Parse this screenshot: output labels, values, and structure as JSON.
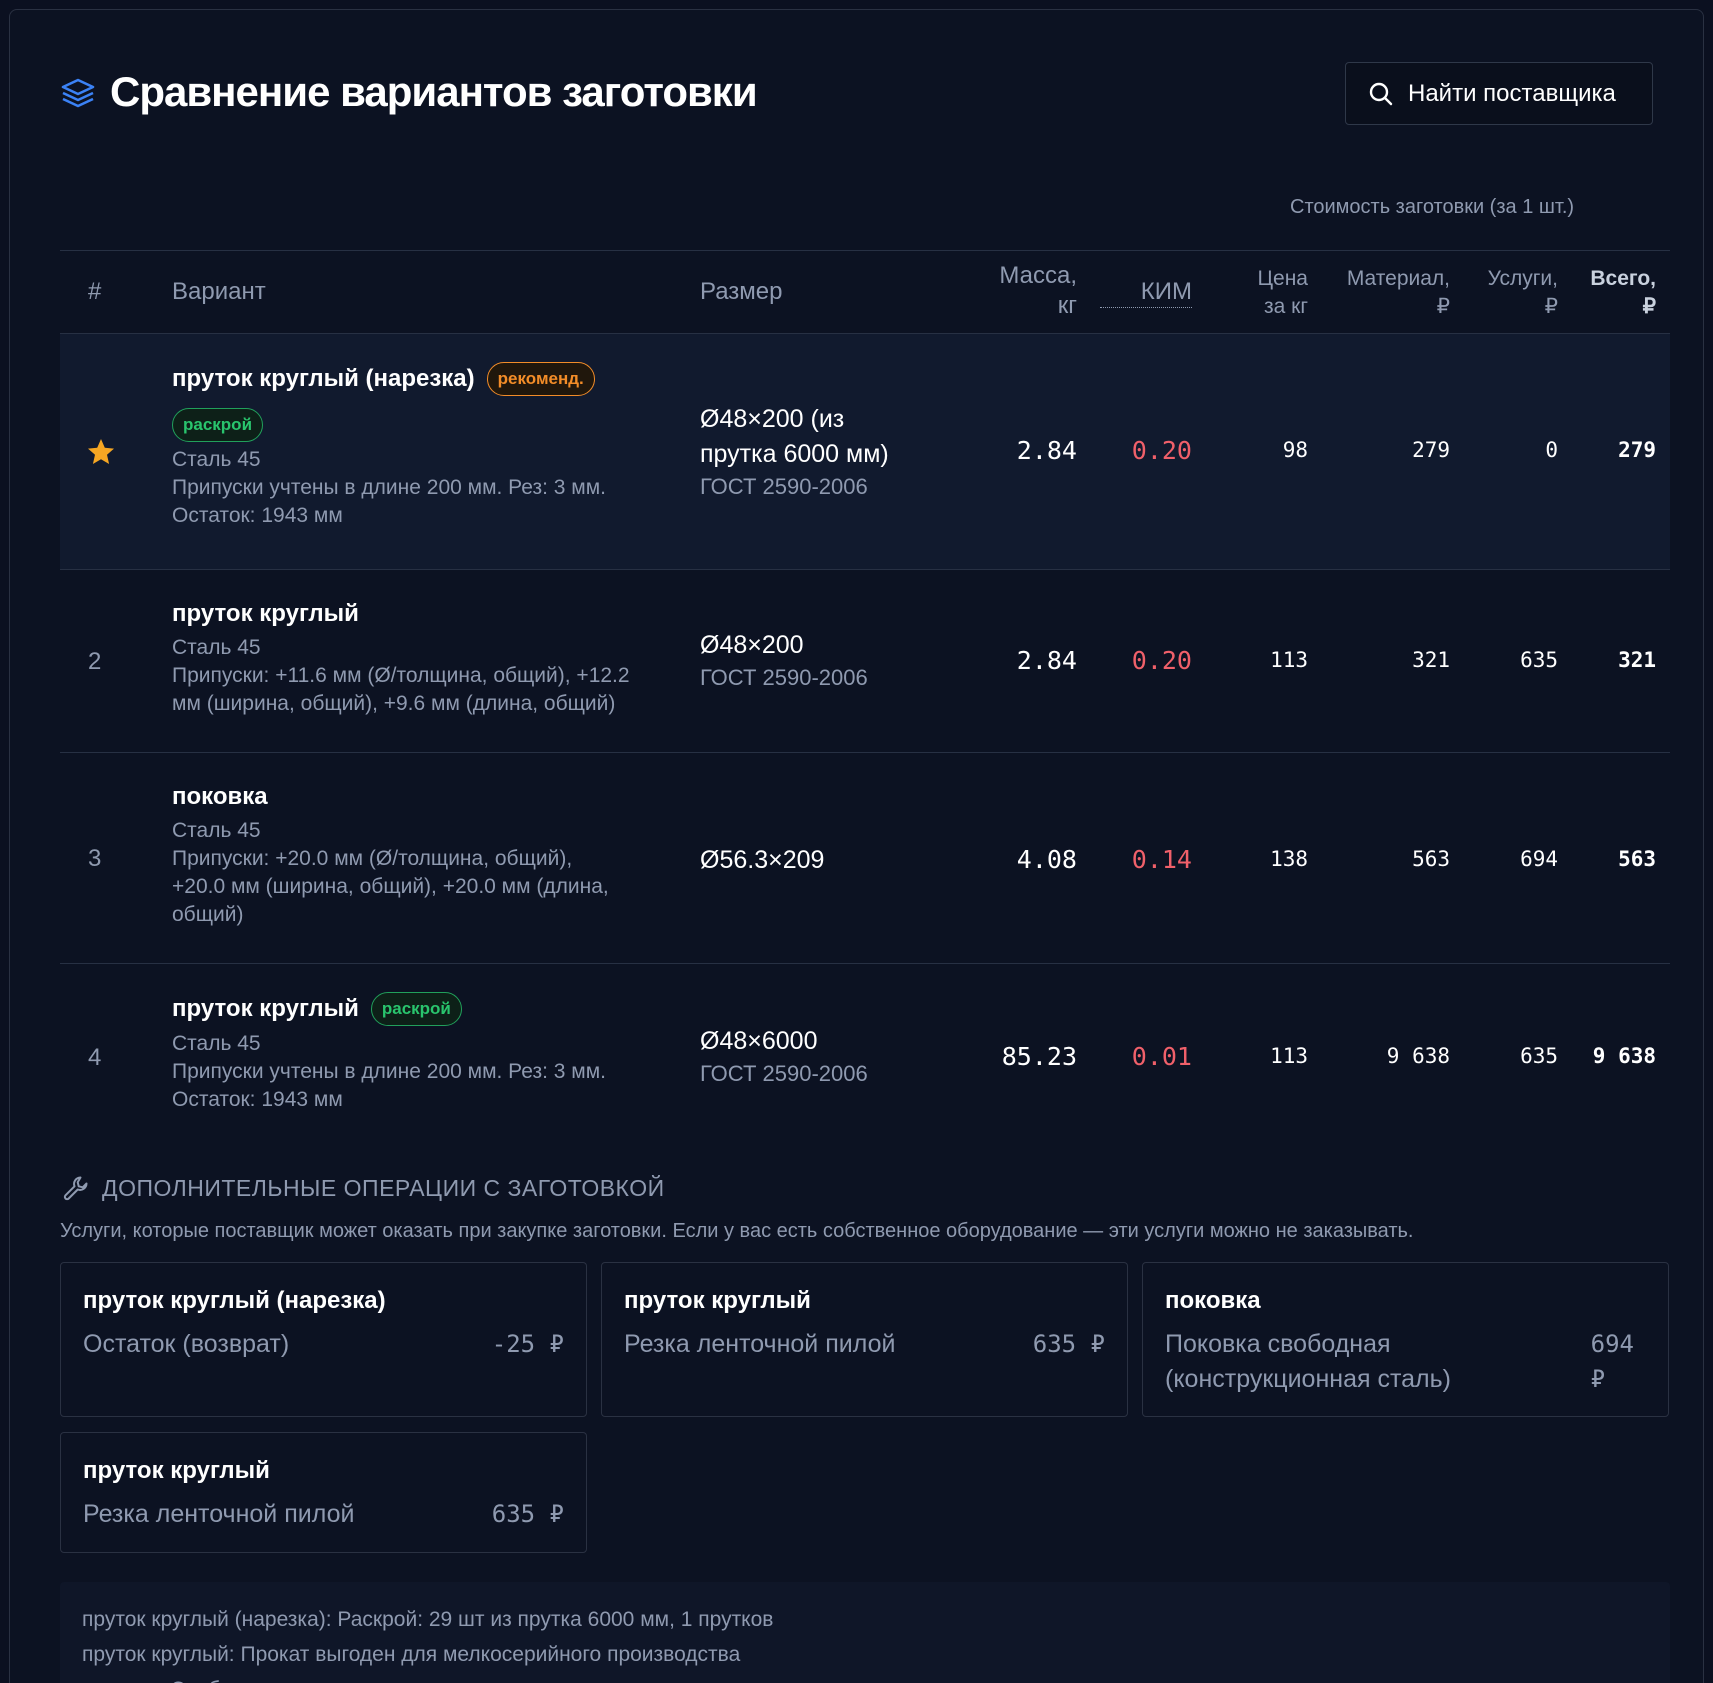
{
  "header": {
    "title": "Сравнение вариантов заготовки",
    "find_button": "Найти поставщика",
    "title_icon": "layers-icon",
    "find_icon": "search-icon"
  },
  "cost_caption": "Стоимость заготовки (за 1 шт.)",
  "columns": {
    "idx": "#",
    "variant": "Вариант",
    "size": "Размер",
    "mass_1": "Масса,",
    "mass_2": "кг",
    "kim": "КИМ",
    "price_1": "Цена",
    "price_2": "за кг",
    "material_1": "Материал,",
    "material_2": "₽",
    "services_1": "Услуги,",
    "services_2": "₽",
    "total_1": "Всего,",
    "total_2": "₽"
  },
  "rows": [
    {
      "index": "",
      "name": "пруток круглый (нарезка)",
      "badge": "рекоменд.",
      "badge2": "раскрой",
      "steel": "Сталь 45",
      "note_1": "Припуски учтены в длине 200 мм. Рез: 3 мм.",
      "note_2": "Остаток: 1943 мм",
      "note_3": "",
      "size_1": "Ø48×200 (из",
      "size_2": "прутка 6000 мм)",
      "gost": "ГОСТ 2590-2006",
      "mass": "2.84",
      "kim": "0.20",
      "price": "98",
      "material": "279",
      "services": "0",
      "total": "279"
    },
    {
      "index": "2",
      "name": "пруток круглый",
      "steel": "Сталь 45",
      "note_1": "Припуски: +11.6 мм (Ø/толщина, общий), +12.2",
      "note_2": "мм (ширина, общий), +9.6 мм (длина, общий)",
      "size_1": "Ø48×200",
      "gost": "ГОСТ 2590-2006",
      "mass": "2.84",
      "kim": "0.20",
      "price": "113",
      "material": "321",
      "services": "635",
      "total": "321"
    },
    {
      "index": "3",
      "name": "поковка",
      "steel": "Сталь 45",
      "note_1": "Припуски: +20.0 мм (Ø/толщина, общий),",
      "note_2": "+20.0 мм (ширина, общий), +20.0 мм (длина,",
      "note_3": "общий)",
      "size_1": "Ø56.3×209",
      "mass": "4.08",
      "kim": "0.14",
      "price": "138",
      "material": "563",
      "services": "694",
      "total": "563"
    },
    {
      "index": "4",
      "name": "пруток круглый",
      "badge": "раскрой",
      "steel": "Сталь 45",
      "note_1": "Припуски учтены в длине 200 мм. Рез: 3 мм.",
      "note_2": "Остаток: 1943 мм",
      "size_1": "Ø48×6000",
      "gost": "ГОСТ 2590-2006",
      "mass": "85.23",
      "kim": "0.01",
      "price": "113",
      "material": "9 638",
      "services": "635",
      "total": "9 638"
    }
  ],
  "ops": {
    "title": "ДОПОЛНИТЕЛЬНЫЕ ОПЕРАЦИИ С ЗАГОТОВКОЙ",
    "icon": "wrench-icon",
    "description": "Услуги, которые поставщик может оказать при закупке заготовки. Если у вас есть собственное оборудование — эти услуги можно не заказывать.",
    "cards": [
      {
        "title": "пруток круглый (нарезка)",
        "desc_1": "Остаток (возврат)",
        "desc_2": "",
        "price_1": "-25 ₽",
        "price_2": ""
      },
      {
        "title": "пруток круглый",
        "desc_1": "Резка ленточной пилой",
        "desc_2": "",
        "price_1": "635 ₽",
        "price_2": ""
      },
      {
        "title": "поковка",
        "desc_1": "Поковка свободная",
        "desc_2": "(конструкционная сталь)",
        "price_1": "694",
        "price_2": "₽"
      },
      {
        "title": "пруток круглый",
        "desc_1": "Резка ленточной пилой",
        "desc_2": "",
        "price_1": "635 ₽",
        "price_2": ""
      }
    ]
  },
  "notes": [
    "пруток круглый (нарезка): Раскрой: 29 шт из прутка 6000 мм, 1 прутков",
    "пруток круглый: Прокат выгоден для мелкосерийного производства",
    "поковка: Свободная ковка возможна, но дороже проката"
  ],
  "colors": {
    "background": "#0b1020",
    "accent_blue": "#3b82f6",
    "kim_red": "#f0606a",
    "badge_orange": "#f28c28",
    "badge_green": "#29c46d",
    "star": "#f5a623"
  }
}
